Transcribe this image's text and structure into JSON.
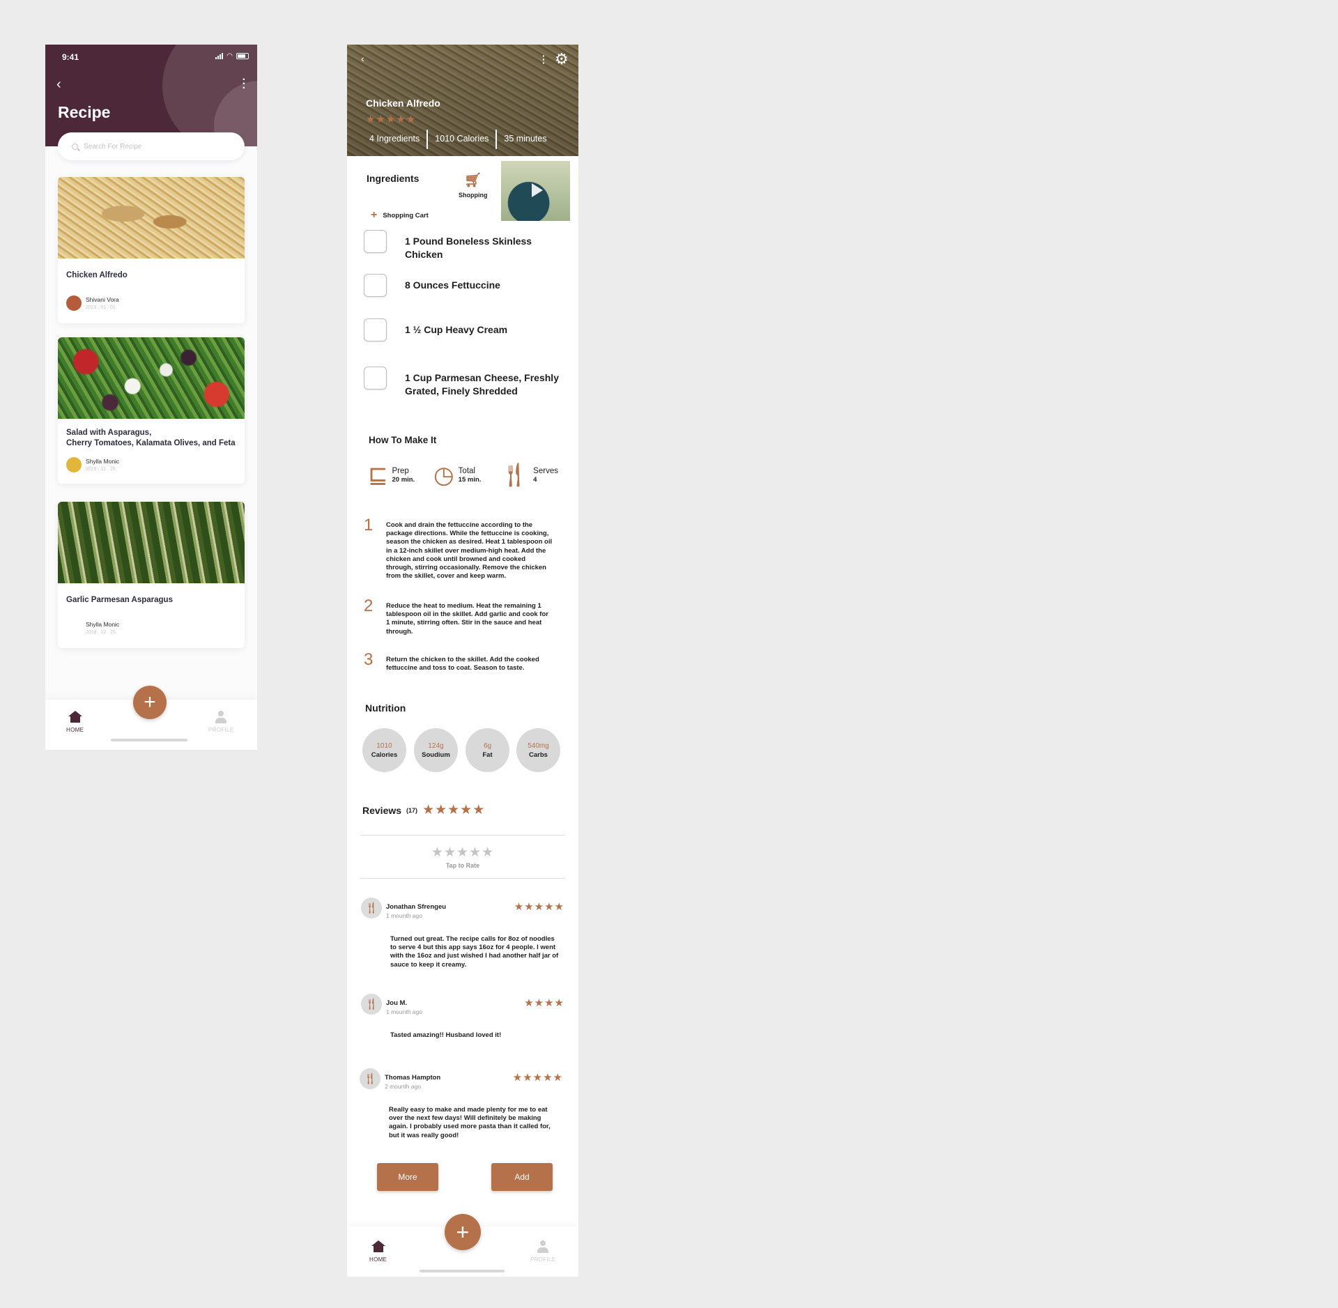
{
  "colors": {
    "accent": "#b5714a",
    "header": "#4d2838",
    "background": "#ececec"
  },
  "home": {
    "status_time": "9:41",
    "title": "Recipe",
    "search_placeholder": "Search For Recipe",
    "cards": [
      {
        "name": "Chicken Alfredo",
        "author": "Shivani Vora",
        "date": "2019 . 01 . 01"
      },
      {
        "name": "Salad with Asparagus,\nCherry Tomatoes, Kalamata Olives, and Feta",
        "author": "Shylla Monic",
        "date": "2018 . 12 . 25"
      },
      {
        "name": "Garlic Parmesan Asparagus",
        "author": "Shylla Monic",
        "date": "2018 . 12 . 25"
      }
    ],
    "tabs": {
      "home": "HOME",
      "profile": "PROFILE"
    },
    "fab": "+"
  },
  "detail": {
    "title": "Chicken Alfredo",
    "rating_stars": "★★★★★",
    "meta": [
      "4 Ingredients",
      "1010 Calories",
      "35 minutes"
    ],
    "ingredients_title": "Ingredients",
    "shopping_label": "Shopping",
    "shopping_cart_label": "Shopping Cart",
    "ingredients": [
      "1 Pound Boneless Skinless Chicken",
      "8 Ounces Fettuccine",
      "1 ½ Cup Heavy Cream",
      "1 Cup Parmesan Cheese, Freshly Grated, Finely Shredded"
    ],
    "how_title": "How To Make It",
    "times": [
      {
        "label": "Prep",
        "value": "20 min."
      },
      {
        "label": "Total",
        "value": "15 min."
      },
      {
        "label": "Serves",
        "value": "4"
      }
    ],
    "steps": [
      {
        "num": "1",
        "text": "Cook and drain the fettuccine according to the package directions. While the fettuccine is cooking, season the chicken as desired. Heat 1 tablespoon oil in a 12-inch skillet over medium-high heat. Add the chicken and cook until browned and cooked through, stirring occasionally. Remove the chicken from the skillet, cover and keep warm."
      },
      {
        "num": "2",
        "text": "Reduce the heat to medium. Heat the remaining 1 tablespoon oil in the skillet. Add garlic and cook for 1 minute, stirring often. Stir in the sauce and heat through."
      },
      {
        "num": "3",
        "text": "Return the chicken to the skillet. Add the cooked fettuccine and toss to coat. Season to taste."
      }
    ],
    "nutrition_title": "Nutrition",
    "nutrition": [
      {
        "value": "1010",
        "label": "Calories"
      },
      {
        "value": "124g",
        "label": "Soudium"
      },
      {
        "value": "6g",
        "label": "Fat"
      },
      {
        "value": "540mg",
        "label": "Carbs"
      }
    ],
    "reviews_title": "Reviews",
    "reviews_count": "(17)",
    "reviews_stars": "★★★★★",
    "tap_stars": "★★★★★",
    "tap_to_rate": "Tap to Rate",
    "reviews": [
      {
        "name": "Jonathan Sfrengeu",
        "ago": "1 mounth ago",
        "stars": "★★★★★",
        "text": "Turned out great. The recipe calls for 8oz of noodles to serve 4 but this app says 16oz for 4 people. I went with the 16oz and just wished I had another half jar of sauce to keep it creamy."
      },
      {
        "name": "Jou M.",
        "ago": "1 mounth ago",
        "stars": "★★★★",
        "text": "Tasted amazing!! Husband loved it!"
      },
      {
        "name": "Thomas Hampton",
        "ago": "2 mounth ago",
        "stars": "★★★★★",
        "text": "Really easy to make and made plenty for me to eat over the next few days! Will definitely be making again. I probably used more pasta than it called for, but it was really good!"
      }
    ],
    "more_button": "More",
    "add_button": "Add",
    "tabs": {
      "home": "HOME",
      "profile": "PROFILE"
    },
    "fab": "+"
  }
}
